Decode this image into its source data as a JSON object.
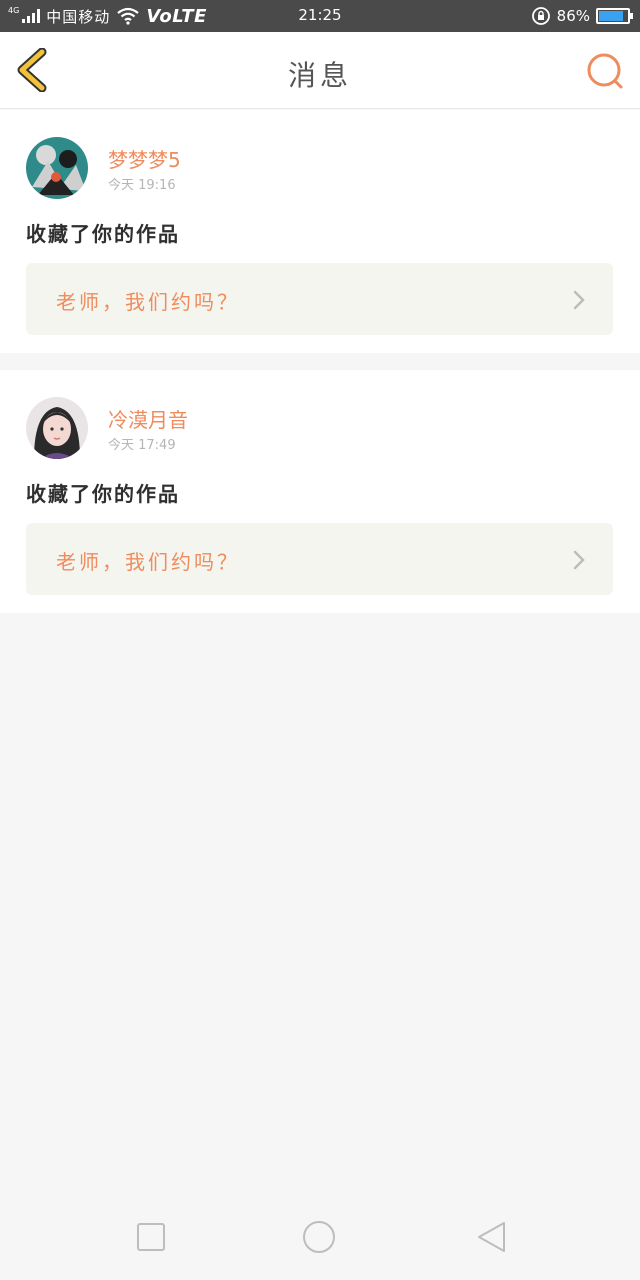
{
  "status_bar": {
    "network": "4G",
    "carrier": "中国移动",
    "volte": "VoLTE",
    "time": "21:25",
    "battery": "86%",
    "battery_level": 0.86
  },
  "header": {
    "title": "消息",
    "back_icon": "back-chevron-icon",
    "search_icon": "search-icon",
    "accent_back": "#f2c23a",
    "accent_search": "#ef8b5c"
  },
  "messages": [
    {
      "username": "梦梦梦5",
      "time": "今天 19:16",
      "action": "收藏了你的作品",
      "quote": "老师，我们约吗？"
    },
    {
      "username": "冷漠月音",
      "time": "今天 17:49",
      "action": "收藏了你的作品",
      "quote": "老师，我们约吗？"
    }
  ],
  "colors": {
    "accent": "#ef8b5c",
    "quote_bg": "#f5f5ef",
    "page_bg": "#f7f6f6"
  }
}
